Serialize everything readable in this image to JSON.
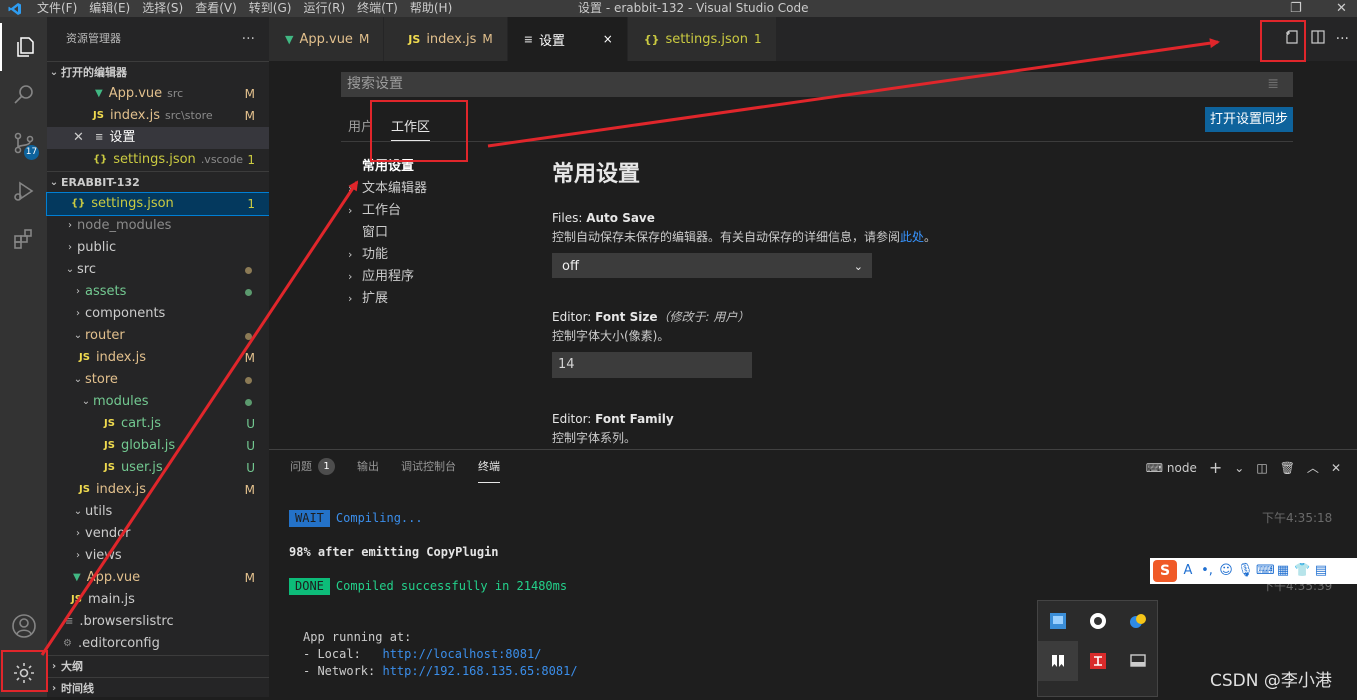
{
  "titlebar": {
    "menus": [
      "文件(F)",
      "编辑(E)",
      "选择(S)",
      "查看(V)",
      "转到(G)",
      "运行(R)",
      "终端(T)",
      "帮助(H)"
    ],
    "window_title": "设置 - erabbit-132 - Visual Studio Code"
  },
  "activity": {
    "scm_badge": "17"
  },
  "sidebar": {
    "title": "资源管理器",
    "more": "···",
    "open_editors": {
      "header": "打开的编辑器",
      "items": [
        {
          "name": "App.vue",
          "desc": "src",
          "status": "M"
        },
        {
          "name": "index.js",
          "desc": "src\\store",
          "status": "M"
        },
        {
          "name": "设置",
          "desc": "",
          "status": ""
        },
        {
          "name": "settings.json",
          "desc": ".vscode",
          "status": "1"
        }
      ]
    },
    "project": {
      "header": "ERABBIT-132",
      "items": [
        {
          "name": "settings.json",
          "status": "1"
        },
        {
          "name": "node_modules",
          "status": ""
        },
        {
          "name": "public",
          "status": ""
        },
        {
          "name": "src",
          "status": ""
        },
        {
          "name": "assets",
          "status": ""
        },
        {
          "name": "components",
          "status": ""
        },
        {
          "name": "router",
          "status": ""
        },
        {
          "name": "index.js",
          "status": "M"
        },
        {
          "name": "store",
          "status": ""
        },
        {
          "name": "modules",
          "status": ""
        },
        {
          "name": "cart.js",
          "status": "U"
        },
        {
          "name": "global.js",
          "status": "U"
        },
        {
          "name": "user.js",
          "status": "U"
        },
        {
          "name": "index.js",
          "status": "M"
        },
        {
          "name": "utils",
          "status": ""
        },
        {
          "name": "vendor",
          "status": ""
        },
        {
          "name": "views",
          "status": ""
        },
        {
          "name": "App.vue",
          "status": "M"
        },
        {
          "name": "main.js",
          "status": ""
        },
        {
          "name": ".browserslistrc",
          "status": ""
        },
        {
          "name": ".editorconfig",
          "status": ""
        }
      ]
    },
    "outline": "大纲",
    "timeline": "时间线"
  },
  "tabs": [
    {
      "label": "App.vue",
      "status": "M"
    },
    {
      "label": "index.js",
      "status": "M"
    },
    {
      "label": "设置",
      "status": "×"
    },
    {
      "label": "settings.json",
      "status": "1"
    }
  ],
  "settings": {
    "search_placeholder": "搜索设置",
    "scope_user": "用户",
    "scope_workspace": "工作区",
    "sync_button": "打开设置同步",
    "toc": [
      "常用设置",
      "文本编辑器",
      "工作台",
      "窗口",
      "功能",
      "应用程序",
      "扩展"
    ],
    "heading": "常用设置",
    "auto_save": {
      "prefix": "Files: ",
      "name": "Auto Save",
      "desc": "控制自动保存未保存的编辑器。有关自动保存的详细信息，请参阅",
      "link": "此处",
      "desc_end": "。",
      "value": "off"
    },
    "font_size": {
      "prefix": "Editor: ",
      "name": "Font Size",
      "modified": "（修改于: 用户）",
      "desc": "控制字体大小(像素)。",
      "value": "14"
    },
    "font_family": {
      "prefix": "Editor: ",
      "name": "Font Family",
      "desc": "控制字体系列。"
    }
  },
  "panel": {
    "tabs": [
      "问题",
      "输出",
      "调试控制台",
      "终端"
    ],
    "problems_count": "1",
    "terminal_name": "node",
    "lines": {
      "wait_tag": "WAIT",
      "wait_text": "Compiling...",
      "wait_time": "下午4:35:18",
      "progress": "98% after emitting CopyPlugin",
      "done_tag": "DONE",
      "done_text": "Compiled successfully in 21480ms",
      "done_time": "下午4:35:39",
      "running": "App running at:",
      "local_label": "- Local:   ",
      "local_url": "http://localhost:8081/",
      "network_label": "- Network: ",
      "network_url": "http://192.168.135.65:8081/"
    }
  },
  "watermark": "CSDN @李小港",
  "colors": {
    "highlight": "#e0262b",
    "accent": "#0e639c"
  }
}
